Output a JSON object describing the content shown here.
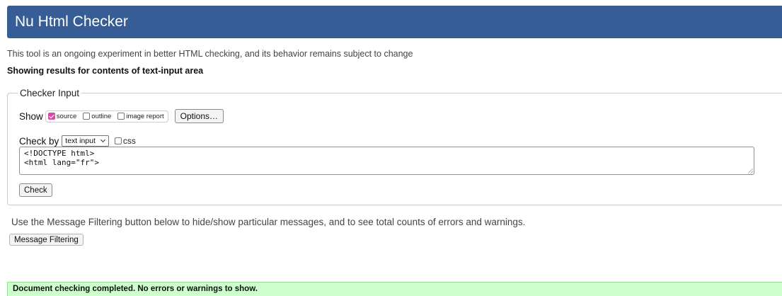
{
  "header": {
    "title": "Nu Html Checker"
  },
  "intro": "This tool is an ongoing experiment in better HTML checking, and its behavior remains subject to change",
  "results_heading": "Showing results for contents of text-input area",
  "checker_input": {
    "legend": "Checker Input",
    "show": {
      "label": "Show",
      "options": [
        {
          "label": "source",
          "checked": true
        },
        {
          "label": "outline",
          "checked": false
        },
        {
          "label": "image report",
          "checked": false
        }
      ],
      "options_button": "Options…"
    },
    "check_by": {
      "label": "Check by",
      "selected": "text input",
      "css_label": "css",
      "css_checked": false
    },
    "textarea_value": "<!DOCTYPE html>\n<html lang=\"fr\">",
    "check_button": "Check"
  },
  "filtering": {
    "note": "Use the Message Filtering button below to hide/show particular messages, and to see total counts of errors and warnings.",
    "button": "Message Filtering"
  },
  "status": {
    "message": "Document checking completed. No errors or warnings to show.",
    "color": "#ccffcc"
  },
  "colors": {
    "header_bg": "#365d95",
    "checkbox_accent": "#d94aa2"
  }
}
